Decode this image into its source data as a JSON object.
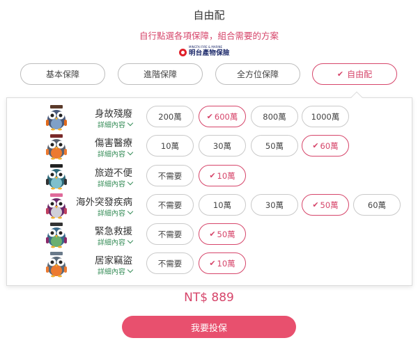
{
  "header": {
    "title": "自由配",
    "subtitle": "自行點選各項保障，組合需要的方案",
    "logo_text": "明台產物保險",
    "logo_small": "MINGTAI FIRE & MARINE"
  },
  "tabs": [
    {
      "label": "基本保障",
      "active": false
    },
    {
      "label": "進階保障",
      "active": false
    },
    {
      "label": "全方位保障",
      "active": false
    },
    {
      "label": "自由配",
      "active": true
    }
  ],
  "check_icon": "✔",
  "detail_label": "詳細內容",
  "coverage_items": [
    {
      "name": "身故殘廢",
      "icon": "owl-death-disability-icon",
      "options": [
        {
          "label": "200萬",
          "selected": false
        },
        {
          "label": "600萬",
          "selected": true
        },
        {
          "label": "800萬",
          "selected": false
        },
        {
          "label": "1000萬",
          "selected": false
        }
      ]
    },
    {
      "name": "傷害醫療",
      "icon": "owl-medical-icon",
      "options": [
        {
          "label": "10萬",
          "selected": false
        },
        {
          "label": "30萬",
          "selected": false
        },
        {
          "label": "50萬",
          "selected": false
        },
        {
          "label": "60萬",
          "selected": true
        }
      ]
    },
    {
      "name": "旅遊不便",
      "icon": "owl-travel-icon",
      "options": [
        {
          "label": "不需要",
          "selected": false
        },
        {
          "label": "10萬",
          "selected": true
        }
      ]
    },
    {
      "name": "海外突發疾病",
      "icon": "owl-overseas-illness-icon",
      "options": [
        {
          "label": "不需要",
          "selected": false
        },
        {
          "label": "10萬",
          "selected": false
        },
        {
          "label": "30萬",
          "selected": false
        },
        {
          "label": "50萬",
          "selected": true
        },
        {
          "label": "60萬",
          "selected": false
        }
      ]
    },
    {
      "name": "緊急救援",
      "icon": "owl-emergency-icon",
      "options": [
        {
          "label": "不需要",
          "selected": false
        },
        {
          "label": "50萬",
          "selected": true
        }
      ]
    },
    {
      "name": "居家竊盜",
      "icon": "owl-burglary-icon",
      "options": [
        {
          "label": "不需要",
          "selected": false
        },
        {
          "label": "10萬",
          "selected": true
        }
      ]
    }
  ],
  "price": "NT$ 889",
  "cta_label": "我要投保",
  "colors": {
    "accent": "#d6456a",
    "cta": "#e8506e",
    "detail": "#3a8f5b"
  }
}
